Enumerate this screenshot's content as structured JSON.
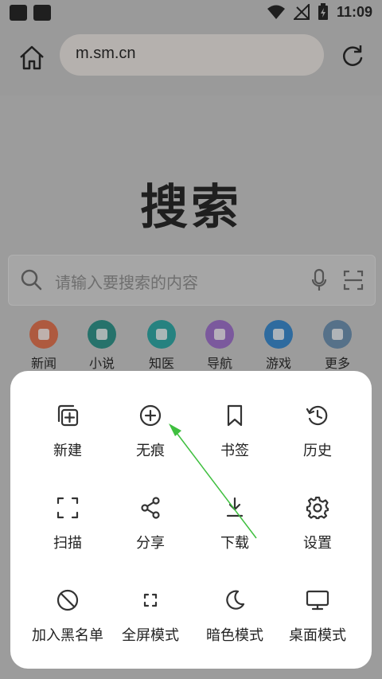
{
  "status_bar": {
    "time": "11:09"
  },
  "browser": {
    "url": "m.sm.cn"
  },
  "page": {
    "logo_text": "搜索",
    "search_placeholder": "请输入要搜索的内容",
    "shortcuts": [
      {
        "label": "新闻",
        "color": "#d9714f"
      },
      {
        "label": "小说",
        "color": "#2f8f86"
      },
      {
        "label": "知医",
        "color": "#2fa3a0"
      },
      {
        "label": "导航",
        "color": "#9a6fc4"
      },
      {
        "label": "游戏",
        "color": "#3a86c7"
      },
      {
        "label": "更多",
        "color": "#6c8dab"
      }
    ]
  },
  "menu": {
    "items": [
      {
        "label": "新建",
        "icon": "new-tab-icon"
      },
      {
        "label": "无痕",
        "icon": "plus-circle-icon"
      },
      {
        "label": "书签",
        "icon": "bookmark-icon"
      },
      {
        "label": "历史",
        "icon": "history-icon"
      },
      {
        "label": "扫描",
        "icon": "scan-icon"
      },
      {
        "label": "分享",
        "icon": "share-icon"
      },
      {
        "label": "下载",
        "icon": "download-icon"
      },
      {
        "label": "设置",
        "icon": "gear-icon"
      },
      {
        "label": "加入黑名单",
        "icon": "block-icon"
      },
      {
        "label": "全屏模式",
        "icon": "fullscreen-icon"
      },
      {
        "label": "暗色模式",
        "icon": "moon-icon"
      },
      {
        "label": "桌面模式",
        "icon": "monitor-icon"
      }
    ]
  },
  "annotation": {
    "color": "#3fbf3f"
  }
}
